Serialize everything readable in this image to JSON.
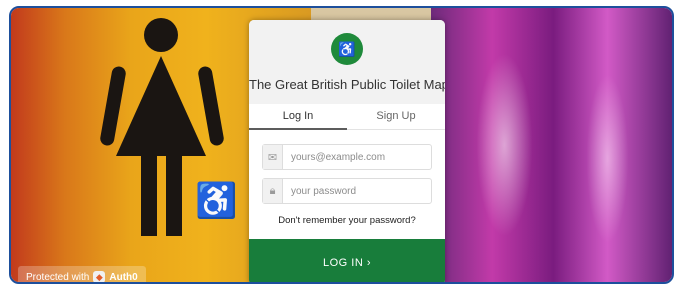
{
  "app": {
    "title": "The Great British Public Toilet Map",
    "logo_icon": "people-wheelchair-logo-icon"
  },
  "tabs": [
    {
      "label": "Log In",
      "active": true
    },
    {
      "label": "Sign Up",
      "active": false
    }
  ],
  "form": {
    "email_placeholder": "yours@example.com",
    "email_value": "",
    "password_placeholder": "your password",
    "password_value": "",
    "forgot_label": "Don't remember your password?",
    "submit_label": "LOG IN ›"
  },
  "badge": {
    "prefix": "Protected with",
    "brand": "Auth0"
  },
  "colors": {
    "accent": "#187d3b",
    "frame": "#1d4f9c"
  }
}
